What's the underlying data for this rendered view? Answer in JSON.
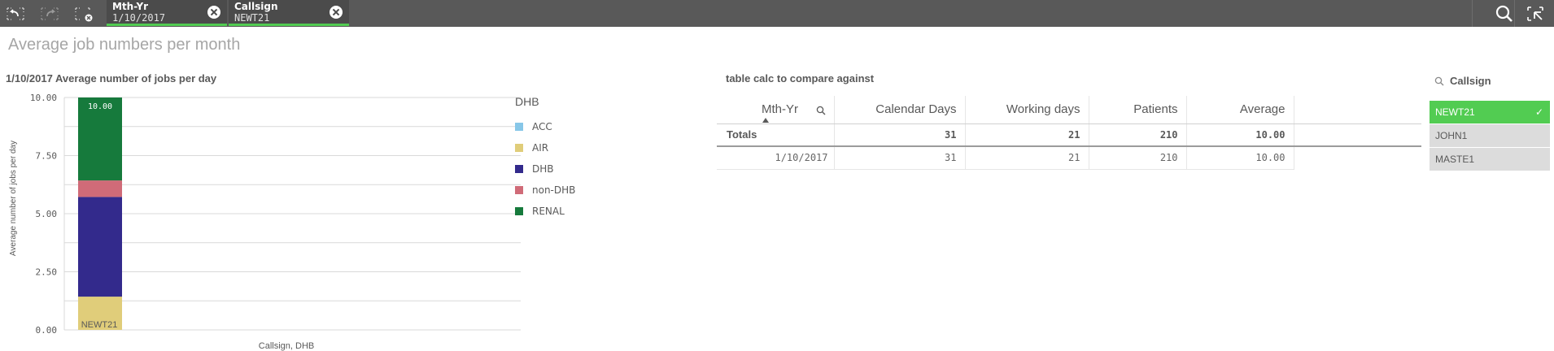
{
  "toolbar": {
    "buttons": [
      "step-back-icon",
      "step-forward-icon",
      "clear-selections-icon"
    ],
    "search_icon": "search-icon",
    "selection_tool_icon": "selections-tool-icon"
  },
  "selections": [
    {
      "field": "Mth-Yr",
      "value": "1/10/2017"
    },
    {
      "field": "Callsign",
      "value": "NEWT21"
    }
  ],
  "sheet_title": "Average job numbers per month",
  "chart": {
    "title": "1/10/2017 Average number of jobs per day",
    "legend_title": "DHB",
    "ylabel": "Average number of jobs per day",
    "xlabel": "Callsign, DHB",
    "data_label": "10.00"
  },
  "chart_data": {
    "type": "bar",
    "stacked": true,
    "title": "1/10/2017 Average number of jobs per day",
    "xlabel": "Callsign, DHB",
    "ylabel": "Average number of jobs per day",
    "categories": [
      "NEWT21"
    ],
    "y_ticks": [
      "0.00",
      "2.50",
      "5.00",
      "7.50",
      "10.00"
    ],
    "ylim": [
      0,
      10
    ],
    "series": [
      {
        "name": "ACC",
        "color": "#87c7e8",
        "values": [
          0
        ]
      },
      {
        "name": "AIR",
        "color": "#e0cd7a",
        "values": [
          1.43
        ]
      },
      {
        "name": "DHB",
        "color": "#332a8c",
        "values": [
          4.29
        ]
      },
      {
        "name": "non-DHB",
        "color": "#d06b78",
        "values": [
          0.71
        ]
      },
      {
        "name": "RENAL",
        "color": "#167a3c",
        "values": [
          3.57
        ]
      }
    ],
    "total_label": "10.00",
    "grid": true,
    "legend_position": "right"
  },
  "table": {
    "title": "table calc to compare against",
    "headers": [
      "Mth-Yr",
      "Calendar Days",
      "Working days",
      "Patients",
      "Average"
    ],
    "totals": [
      "Totals",
      "31",
      "21",
      "210",
      "10.00"
    ],
    "rows": [
      [
        "1/10/2017",
        "31",
        "21",
        "210",
        "10.00"
      ]
    ]
  },
  "filter": {
    "title": "Callsign",
    "items": [
      {
        "label": "NEWT21",
        "state": "selected"
      },
      {
        "label": "JOHN1",
        "state": "alternative"
      },
      {
        "label": "MASTE1",
        "state": "alternative"
      }
    ],
    "check_mark": "✓"
  },
  "colors": {
    "toolbar_bg": "#595959",
    "selected_green": "#52cc52",
    "alternative_gray": "#dcdcdc"
  }
}
